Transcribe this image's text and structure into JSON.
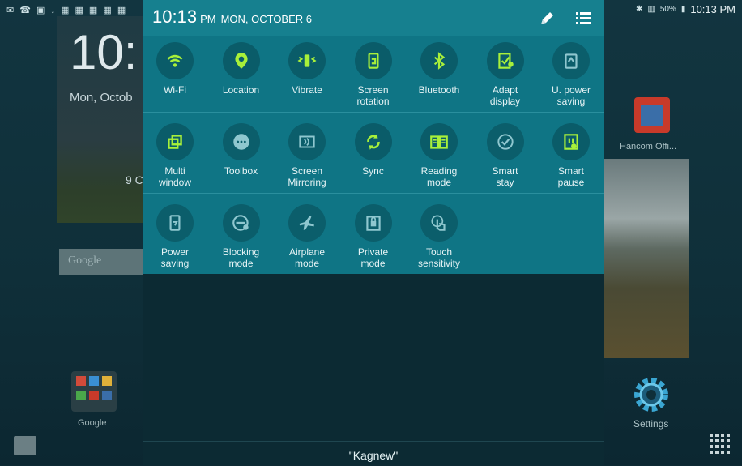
{
  "status_bar": {
    "time": "10:13 PM",
    "battery": "50%"
  },
  "home": {
    "clock": "10:",
    "date": "Mon, Octob",
    "location_fragment": "9 C",
    "search_placeholder": "Google",
    "folder_label": "Google",
    "right_app_label": "Hancom Offi...",
    "settings_label": "Settings"
  },
  "panel": {
    "time": "10:13",
    "ampm": "PM",
    "date": "MON, OCTOBER 6",
    "network": "\"Kagnew\"",
    "colors": {
      "header": "#16808f",
      "tiles_bg": "#0f7585",
      "icon_on": "#a8f03a",
      "icon_off": "#8fc7cf"
    },
    "tiles": [
      {
        "label": "Wi-Fi",
        "icon": "wifi-icon",
        "on": true
      },
      {
        "label": "Location",
        "icon": "location-icon",
        "on": true
      },
      {
        "label": "Vibrate",
        "icon": "vibrate-icon",
        "on": true
      },
      {
        "label": "Screen\nrotation",
        "icon": "screen-rotation-icon",
        "on": true
      },
      {
        "label": "Bluetooth",
        "icon": "bluetooth-icon",
        "on": true
      },
      {
        "label": "Adapt\ndisplay",
        "icon": "adapt-display-icon",
        "on": true
      },
      {
        "label": "U. power\nsaving",
        "icon": "ultra-power-saving-icon",
        "on": false
      },
      {
        "label": "Multi\nwindow",
        "icon": "multi-window-icon",
        "on": true
      },
      {
        "label": "Toolbox",
        "icon": "toolbox-icon",
        "on": false
      },
      {
        "label": "Screen\nMirroring",
        "icon": "screen-mirroring-icon",
        "on": false
      },
      {
        "label": "Sync",
        "icon": "sync-icon",
        "on": true
      },
      {
        "label": "Reading\nmode",
        "icon": "reading-mode-icon",
        "on": true
      },
      {
        "label": "Smart\nstay",
        "icon": "smart-stay-icon",
        "on": false
      },
      {
        "label": "Smart\npause",
        "icon": "smart-pause-icon",
        "on": true
      },
      {
        "label": "Power\nsaving",
        "icon": "power-saving-icon",
        "on": false
      },
      {
        "label": "Blocking\nmode",
        "icon": "blocking-mode-icon",
        "on": false
      },
      {
        "label": "Airplane\nmode",
        "icon": "airplane-mode-icon",
        "on": false
      },
      {
        "label": "Private\nmode",
        "icon": "private-mode-icon",
        "on": false
      },
      {
        "label": "Touch\nsensitivity",
        "icon": "touch-sensitivity-icon",
        "on": false
      }
    ]
  }
}
